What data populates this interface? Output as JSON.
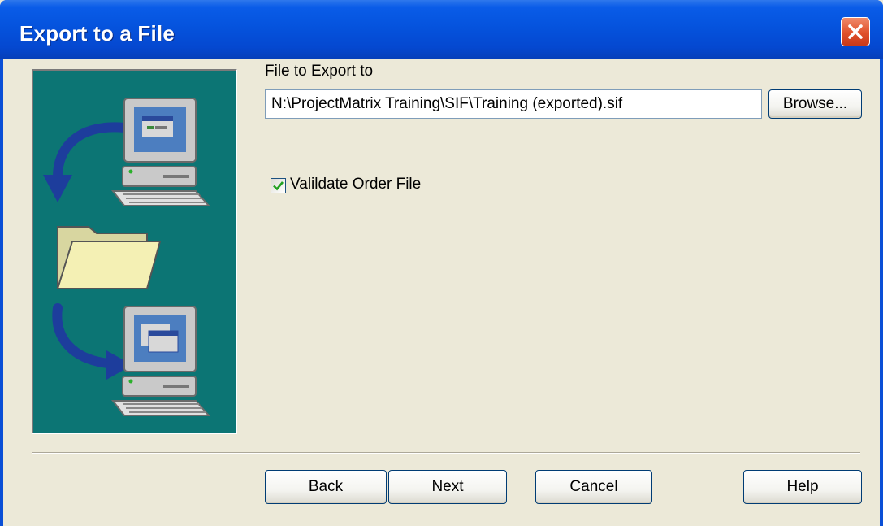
{
  "window": {
    "title": "Export to a File"
  },
  "file_section": {
    "label": "File to Export to",
    "path_value": "N:\\ProjectMatrix Training\\SIF\\Training (exported).sif",
    "browse_label": "Browse..."
  },
  "validate": {
    "label": "Valildate Order File",
    "checked": true
  },
  "buttons": {
    "back": "Back",
    "next": "Next",
    "cancel": "Cancel",
    "help": "Help"
  },
  "colors": {
    "titlebar": "#0553dd",
    "side_panel": "#0c7574",
    "dialog_bg": "#ece9d8",
    "close_button": "#e0502a",
    "check_mark": "#21a121"
  }
}
